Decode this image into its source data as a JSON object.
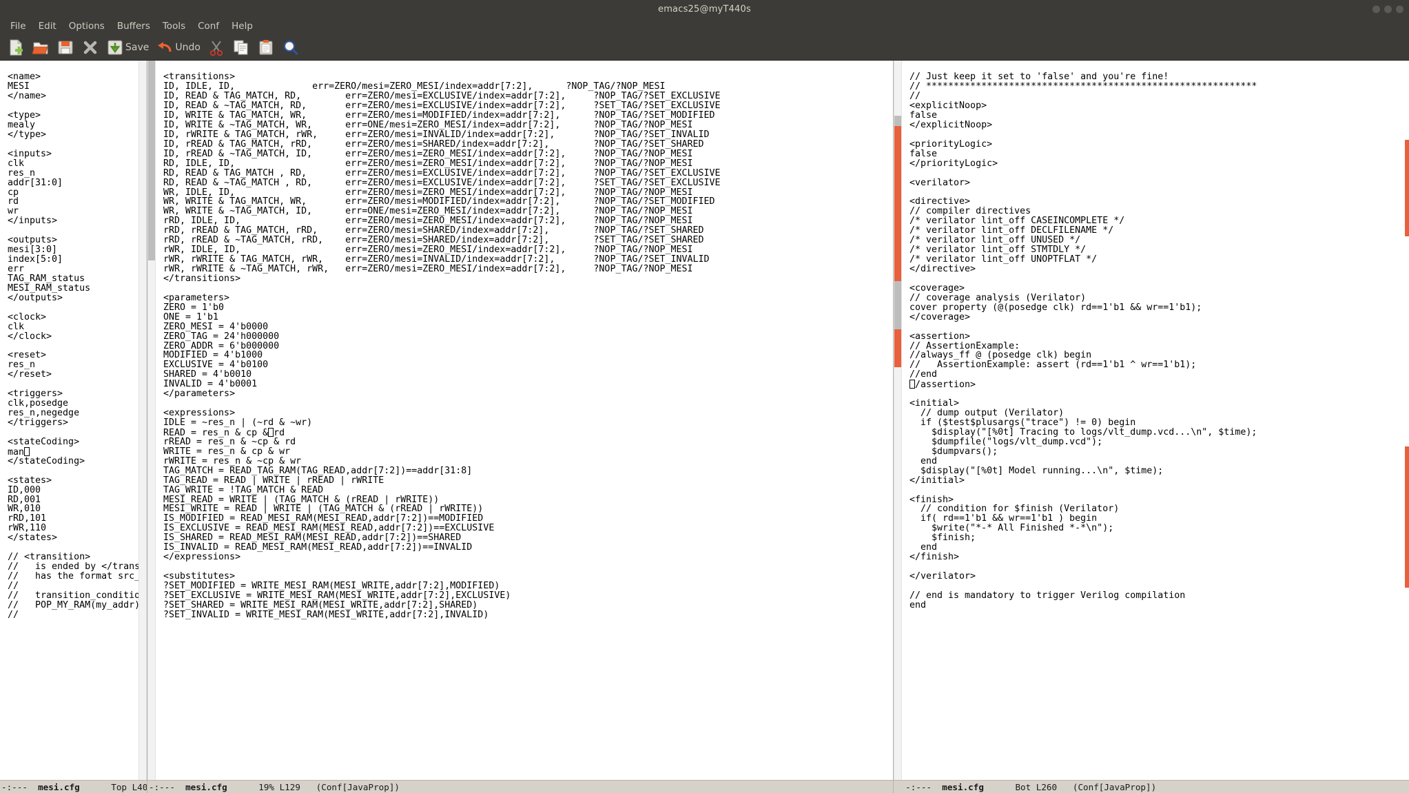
{
  "window": {
    "title": "emacs25@myT440s",
    "buttons": [
      "minimize",
      "maximize",
      "close"
    ]
  },
  "menubar": {
    "items": [
      {
        "label": "File",
        "name": "menu-file"
      },
      {
        "label": "Edit",
        "name": "menu-edit"
      },
      {
        "label": "Options",
        "name": "menu-options"
      },
      {
        "label": "Buffers",
        "name": "menu-buffers"
      },
      {
        "label": "Tools",
        "name": "menu-tools"
      },
      {
        "label": "Conf",
        "name": "menu-conf"
      },
      {
        "label": "Help",
        "name": "menu-help"
      }
    ]
  },
  "toolbar": {
    "buttons": [
      {
        "icon": "new-file-icon",
        "label": ""
      },
      {
        "icon": "open-folder-icon",
        "label": ""
      },
      {
        "icon": "save-disk-icon",
        "label": ""
      },
      {
        "icon": "close-x-icon",
        "label": ""
      },
      {
        "icon": "save-down-arrow-icon",
        "label": "Save"
      },
      {
        "icon": "undo-arrow-icon",
        "label": "Undo"
      },
      {
        "icon": "cut-scissors-icon",
        "label": ""
      },
      {
        "icon": "copy-icon",
        "label": ""
      },
      {
        "icon": "paste-clipboard-icon",
        "label": ""
      },
      {
        "icon": "search-magnifier-icon",
        "label": ""
      }
    ]
  },
  "panes": {
    "left": {
      "modeline": {
        "indicators": "-:---",
        "buffer": "mesi.cfg",
        "position": "Top L40",
        "mode": ""
      },
      "lines": [
        "<name>",
        "MESI",
        "</name>",
        "",
        "<type>",
        "mealy",
        "</type>",
        "",
        "<inputs>",
        "clk",
        "res_n",
        "addr[31:0]",
        "cp",
        "rd",
        "wr",
        "</inputs>",
        "",
        "<outputs>",
        "mesi[3:0]",
        "index[5:0]",
        "err",
        "TAG_RAM_status",
        "MESI_RAM_status",
        "</outputs>",
        "",
        "<clock>",
        "clk",
        "</clock>",
        "",
        "<reset>",
        "res_n",
        "</reset>",
        "",
        "<triggers>",
        "clk,posedge",
        "res_n,negedge",
        "</triggers>",
        "",
        "<stateCoding>",
        "man\u0000CURSOR\u0000",
        "</stateCoding>",
        "",
        "<states>",
        "ID,000",
        "RD,001",
        "WR,010",
        "rRD,101",
        "rWR,110",
        "</states>",
        "",
        "// <transition>",
        "//   is ended by </transiti\u0000ARROW\u0000",
        "//   has the format src_sta\u0000ARROW\u0000",
        "//",
        "//   transition_condition c\u0000ARROW\u0000",
        "//   POP_MY_RAM(my_addr) to\u0000ARROW\u0000",
        "//"
      ]
    },
    "middle": {
      "modeline": {
        "indicators": "-:---",
        "buffer": "mesi.cfg",
        "position": "19% L129",
        "mode": "(Conf[JavaProp])"
      },
      "lines": [
        "<transitions>",
        "ID, IDLE, ID,              err=ZERO/mesi=ZERO_MESI/index=addr[7:2],      ?NOP_TAG/?NOP_MESI",
        "ID, READ & TAG_MATCH, RD,        err=ZERO/mesi=EXCLUSIVE/index=addr[7:2],     ?NOP_TAG/?SET_EXCLUSIVE",
        "ID, READ & ~TAG_MATCH, RD,       err=ZERO/mesi=EXCLUSIVE/index=addr[7:2],     ?SET_TAG/?SET_EXCLUSIVE",
        "ID, WRITE & TAG_MATCH, WR,       err=ZERO/mesi=MODIFIED/index=addr[7:2],      ?NOP_TAG/?SET_MODIFIED",
        "ID, WRITE & ~TAG_MATCH, WR,      err=ONE/mesi=ZERO_MESI/index=addr[7:2],      ?NOP_TAG/?NOP_MESI",
        "ID, rWRITE & TAG_MATCH, rWR,     err=ZERO/mesi=INVALID/index=addr[7:2],       ?NOP_TAG/?SET_INVALID",
        "ID, rREAD & TAG_MATCH, rRD,      err=ZERO/mesi=SHARED/index=addr[7:2],        ?NOP_TAG/?SET_SHARED",
        "ID, rREAD & ~TAG_MATCH, ID,      err=ZERO/mesi=ZERO_MESI/index=addr[7:2],     ?NOP_TAG/?NOP_MESI",
        "RD, IDLE, ID,                    err=ZERO/mesi=ZERO_MESI/index=addr[7:2],     ?NOP_TAG/?NOP_MESI",
        "RD, READ & TAG_MATCH , RD,       err=ZERO/mesi=EXCLUSIVE/index=addr[7:2],     ?NOP_TAG/?SET_EXCLUSIVE",
        "RD, READ & ~TAG_MATCH , RD,      err=ZERO/mesi=EXCLUSIVE/index=addr[7:2],     ?SET_TAG/?SET_EXCLUSIVE",
        "WR, IDLE, ID,                    err=ZERO/mesi=ZERO_MESI/index=addr[7:2],     ?NOP_TAG/?NOP_MESI",
        "WR, WRITE & TAG_MATCH, WR,       err=ZERO/mesi=MODIFIED/index=addr[7:2],      ?NOP_TAG/?SET_MODIFIED",
        "WR, WRITE & ~TAG_MATCH, ID,      err=ONE/mesi=ZERO_MESI/index=addr[7:2],      ?NOP_TAG/?NOP_MESI",
        "rRD, IDLE, ID,                   err=ZERO/mesi=ZERO_MESI/index=addr[7:2],     ?NOP_TAG/?NOP_MESI",
        "rRD, rREAD & TAG_MATCH, rRD,     err=ZERO/mesi=SHARED/index=addr[7:2],        ?NOP_TAG/?SET_SHARED",
        "rRD, rREAD & ~TAG_MATCH, rRD,    err=ZERO/mesi=SHARED/index=addr[7:2],        ?SET_TAG/?SET_SHARED",
        "rWR, IDLE, ID,                   err=ZERO/mesi=ZERO_MESI/index=addr[7:2],     ?NOP_TAG/?NOP_MESI",
        "rWR, rWRITE & TAG_MATCH, rWR,    err=ZERO/mesi=INVALID/index=addr[7:2],       ?NOP_TAG/?SET_INVALID",
        "rWR, rWRITE & ~TAG_MATCH, rWR,   err=ZERO/mesi=ZERO_MESI/index=addr[7:2],     ?NOP_TAG/?NOP_MESI",
        "</transitions>",
        "",
        "<parameters>",
        "ZERO = 1'b0",
        "ONE = 1'b1",
        "ZERO_MESI = 4'b0000",
        "ZERO_TAG = 24'h000000",
        "ZERO_ADDR = 6'b000000",
        "MODIFIED = 4'b1000",
        "EXCLUSIVE = 4'b0100",
        "SHARED = 4'b0010",
        "INVALID = 4'b0001",
        "</parameters>",
        "",
        "<expressions>",
        "IDLE = ~res_n | (~rd & ~wr)",
        "READ = res_n & cp &\u0000CURSOR\u0000rd",
        "rREAD = res_n & ~cp & rd",
        "WRITE = res_n & cp & wr",
        "rWRITE = res_n & ~cp & wr",
        "TAG_MATCH = READ_TAG_RAM(TAG_READ,addr[7:2])==addr[31:8]",
        "TAG_READ = READ | WRITE | rREAD | rWRITE",
        "TAG_WRITE = !TAG_MATCH & READ",
        "MESI_READ = WRITE | (TAG_MATCH & (rREAD | rWRITE))",
        "MESI_WRITE = READ | WRITE | (TAG_MATCH & (rREAD | rWRITE))",
        "IS_MODIFIED = READ_MESI_RAM(MESI_READ,addr[7:2])==MODIFIED",
        "IS_EXCLUSIVE = READ_MESI_RAM(MESI_READ,addr[7:2])==EXCLUSIVE",
        "IS_SHARED = READ_MESI_RAM(MESI_READ,addr[7:2])==SHARED",
        "IS_INVALID = READ_MESI_RAM(MESI_READ,addr[7:2])==INVALID",
        "</expressions>",
        "",
        "<substitutes>",
        "?SET_MODIFIED = WRITE_MESI_RAM(MESI_WRITE,addr[7:2],MODIFIED)",
        "?SET_EXCLUSIVE = WRITE_MESI_RAM(MESI_WRITE,addr[7:2],EXCLUSIVE)",
        "?SET_SHARED = WRITE_MESI_RAM(MESI_WRITE,addr[7:2],SHARED)",
        "?SET_INVALID = WRITE_MESI_RAM(MESI_WRITE,addr[7:2],INVALID)"
      ]
    },
    "right": {
      "modeline": {
        "indicators": "-:---",
        "buffer": "mesi.cfg",
        "position": "Bot L260",
        "mode": "(Conf[JavaProp])"
      },
      "lines": [
        "// Just keep it set to 'false' and you're fine!",
        "// ************************************************************",
        "//",
        "<explicitNoop>",
        "false",
        "</explicitNoop>",
        "",
        "<priorityLogic>",
        "false",
        "</priorityLogic>",
        "",
        "<verilator>",
        "",
        "<directive>",
        "// compiler directives",
        "/* verilator lint_off CASEINCOMPLETE */",
        "/* verilator lint_off DECLFILENAME */",
        "/* verilator lint_off UNUSED */",
        "/* verilator lint_off STMTDLY */",
        "/* verilator lint_off UNOPTFLAT */",
        "</directive>",
        "",
        "<coverage>",
        "// coverage analysis (Verilator)",
        "cover property (@(posedge clk) rd==1'b1 && wr==1'b1);",
        "</coverage>",
        "",
        "<assertion>",
        "// AssertionExample:",
        "//always_ff @ (posedge clk) begin",
        "//   AssertionExample: assert (rd==1'b1 ^ wr==1'b1);",
        "//end",
        "\u0000CURSOR\u0000/assertion>",
        "",
        "<initial>",
        "  // dump output (Verilator)",
        "  if ($test$plusargs(\"trace\") != 0) begin",
        "    $display(\"[%0t] Tracing to logs/vlt_dump.vcd...\\n\", $time);",
        "    $dumpfile(\"logs/vlt_dump.vcd\");",
        "    $dumpvars();",
        "  end",
        "  $display(\"[%0t] Model running...\\n\", $time);",
        "</initial>",
        "",
        "<finish>",
        "  // condition for $finish (Verilator)",
        "  if( rd==1'b1 && wr==1'b1 ) begin",
        "    $write(\"*-* All Finished *-*\\n\");",
        "    $finish;",
        "  end",
        "</finish>",
        "",
        "</verilator>",
        "",
        "// end is mandatory to trigger Verilog compilation",
        "end"
      ]
    }
  },
  "colors": {
    "chrome": "#3c3b37",
    "menu_text": "#d0cabf",
    "editor_bg": "#ffffff",
    "editor_fg": "#000000",
    "modeline_bg": "#d6d2ca",
    "scrollbar_thumb": "#bdbdbd",
    "mark_orange": "#e8603c"
  }
}
